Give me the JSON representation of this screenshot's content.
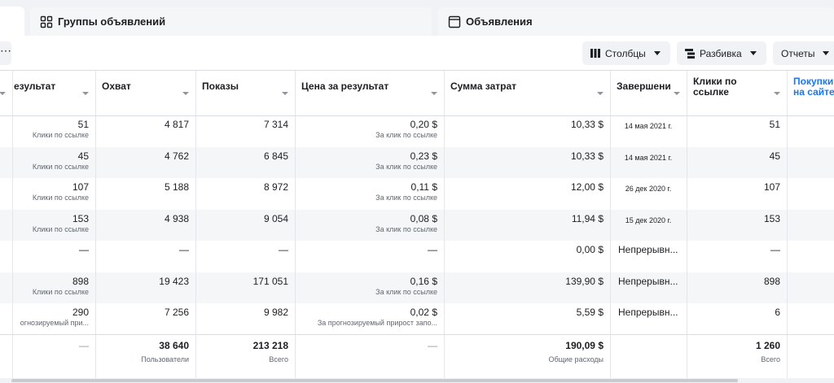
{
  "tabs": {
    "adsets_label": "Группы объявлений",
    "ads_label": "Объявления"
  },
  "toolbar": {
    "dots": "⋯",
    "columns_label": "Столбцы",
    "breakdown_label": "Разбивка",
    "reports_label": "Отчеты"
  },
  "columns": {
    "result": "езультат",
    "reach": "Охват",
    "impressions": "Показы",
    "cost_per_result": "Цена за результат",
    "amount_spent": "Сумма затрат",
    "ends": "Завершени",
    "link_clicks": "Клики по ссылке",
    "purchases": "Покупки на сайте"
  },
  "rows": [
    {
      "result": "51",
      "result_sub": "Клики по ссылке",
      "reach": "4 817",
      "impressions": "7 314",
      "cpr": "0,20 $",
      "cpr_sub": "За клик по ссылке",
      "spent": "10,33 $",
      "ends": "14 мая 2021 г.",
      "clicks": "51"
    },
    {
      "result": "45",
      "result_sub": "Клики по ссылке",
      "reach": "4 762",
      "impressions": "6 845",
      "cpr": "0,23 $",
      "cpr_sub": "За клик по ссылке",
      "spent": "10,33 $",
      "ends": "14 мая 2021 г.",
      "clicks": "45"
    },
    {
      "result": "107",
      "result_sub": "Клики по ссылке",
      "reach": "5 188",
      "impressions": "8 972",
      "cpr": "0,11 $",
      "cpr_sub": "За клик по ссылке",
      "spent": "12,00 $",
      "ends": "26 дек 2020 г.",
      "clicks": "107"
    },
    {
      "result": "153",
      "result_sub": "Клики по ссылке",
      "reach": "4 938",
      "impressions": "9 054",
      "cpr": "0,08 $",
      "cpr_sub": "За клик по ссылке",
      "spent": "11,94 $",
      "ends": "15 дек 2020 г.",
      "clicks": "153"
    },
    {
      "result": "—",
      "result_sub": "",
      "reach": "—",
      "impressions": "—",
      "cpr": "—",
      "cpr_sub": "",
      "spent": "0,00 $",
      "ends": "Непрерывн...",
      "clicks": "—"
    },
    {
      "result": "898",
      "result_sub": "Клики по ссылке",
      "reach": "19 423",
      "impressions": "171 051",
      "cpr": "0,16 $",
      "cpr_sub": "За клик по ссылке",
      "spent": "139,90 $",
      "ends": "Непрерывн...",
      "clicks": "898"
    },
    {
      "result": "290",
      "result_sub": "огнозируемый при...",
      "reach": "7 256",
      "impressions": "9 982",
      "cpr": "0,02 $",
      "cpr_sub": "За прогнозируемый прирост запо...",
      "spent": "5,59 $",
      "ends": "Непрерывн...",
      "clicks": "6"
    }
  ],
  "totals": {
    "result": "—",
    "reach": "38 640",
    "reach_sub": "Пользователи",
    "impressions": "213 218",
    "impressions_sub": "Всего",
    "cpr": "—",
    "spent": "190,09 $",
    "spent_sub": "Общие расходы",
    "clicks": "1 260",
    "clicks_sub": "Всего"
  }
}
